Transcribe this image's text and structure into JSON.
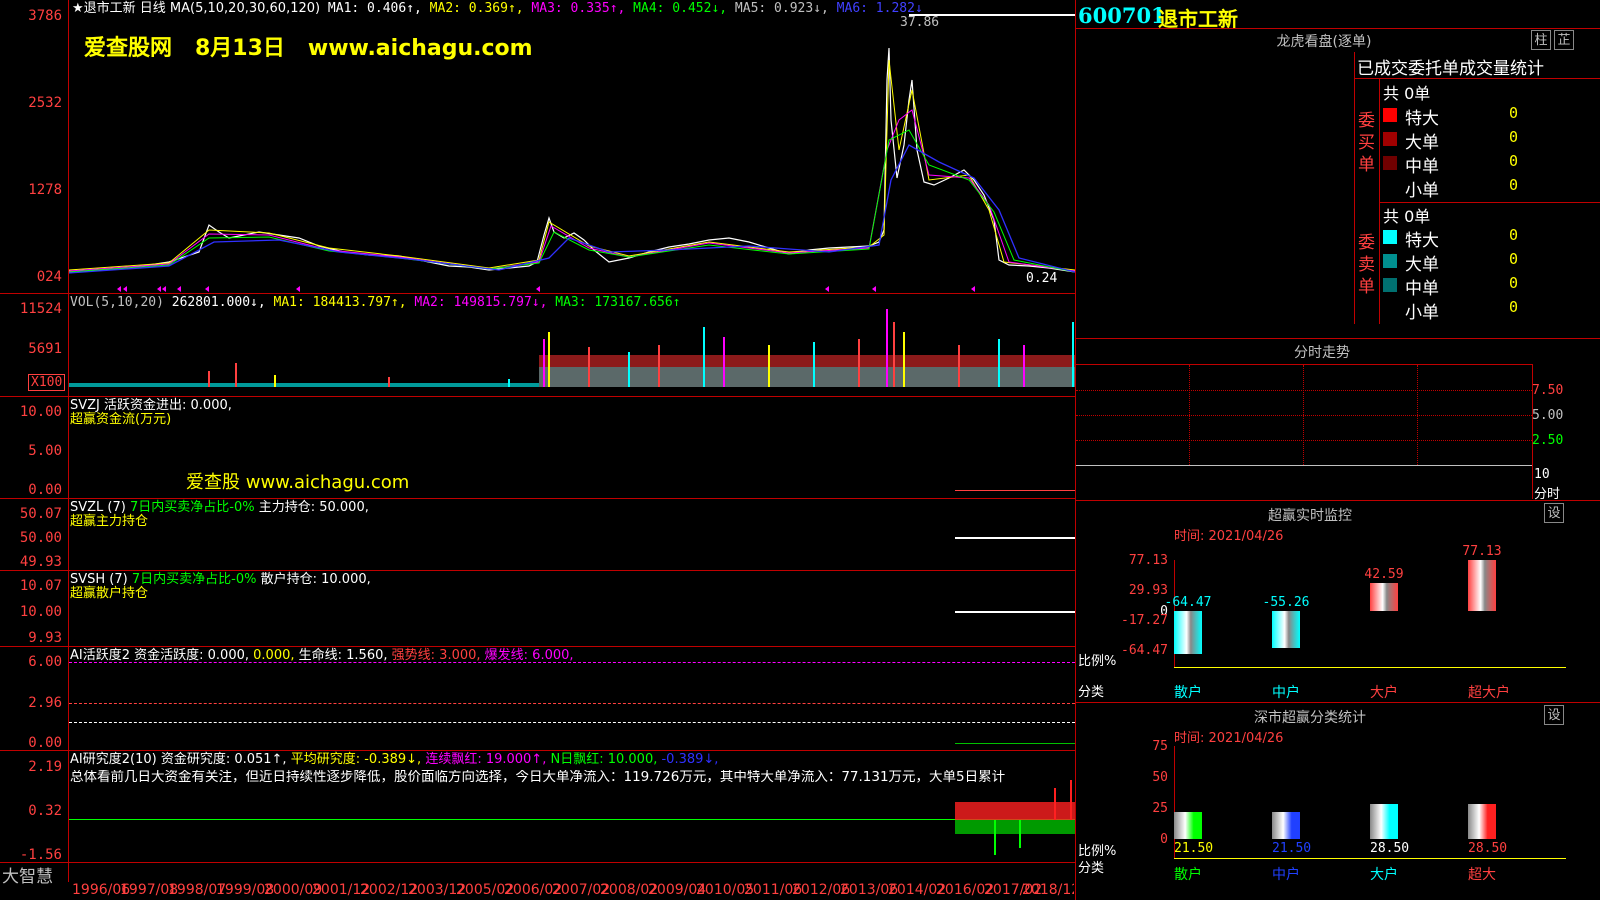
{
  "header": {
    "indicator_line": "★退市工新  日线 MA(5,10,20,30,60,120)",
    "ma1": "MA1: 0.406↑,",
    "ma2": "MA2: 0.369↑,",
    "ma3": "MA3: 0.335↑,",
    "ma4": "MA4: 0.452↓,",
    "ma5": "MA5: 0.923↓,",
    "ma6": "MA6: 1.282↓",
    "peak": "37.86",
    "last": "0.24"
  },
  "watermark1": "爱查股网   8月13日   www.aichagu.com",
  "watermark2": "爱查股 www.aichagu.com",
  "price_axis": [
    "3786",
    "2532",
    "1278",
    "024"
  ],
  "vol": {
    "title": "VOL(5,10,20)",
    "value": "262801.000↓,",
    "ma1": "MA1: 184413.797↑,",
    "ma2": "MA2: 149815.797↓,",
    "ma3": "MA3: 173167.656↑",
    "axis": [
      "11524",
      "5691"
    ],
    "unit": "X100"
  },
  "svzj": {
    "title": "SVZJ  活跃资金进出: 0.000,",
    "sub": "超赢资金流(万元)",
    "axis": [
      "10.00",
      "5.00",
      "0.00"
    ]
  },
  "svzl": {
    "title": "SVZL (7)",
    "green": "7日内买卖净占比-0%",
    "rest": "主力持仓: 50.000,",
    "sub": "超赢主力持仓",
    "axis": [
      "50.07",
      "50.00",
      "49.93"
    ]
  },
  "svsh": {
    "title": "SVSH (7)",
    "green": "7日内买卖净占比-0%",
    "rest": "散户持仓: 10.000,",
    "sub": "超赢散户持仓",
    "axis": [
      "10.07",
      "10.00",
      "9.93"
    ]
  },
  "ai_active": {
    "title": "AI活跃度2 资金活跃度: 0.000,",
    "yellow": "0.000,",
    "rest": "生命线: 1.560,",
    "red": "强势线: 3.000,",
    "mag": "爆发线: 6.000,",
    "axis": [
      "6.00",
      "2.96",
      "0.00"
    ]
  },
  "ai_research": {
    "title": "AI研究度2(10) 资金研究度: 0.051↑,",
    "avg": "平均研究度: -0.389↓,",
    "conred": "连续飘红: 19.000↑,",
    "nred": "N日飘红: 10.000,",
    "neg": "-0.389↓,",
    "summary": "总体看前几日大资金有关注，但近日持续性逐步降低，股价面临方向选择，今日大单净流入：119.726万元，其中特大单净流入：77.131万元，大单5日累计",
    "axis": [
      "2.19",
      "0.32",
      "-1.56"
    ]
  },
  "x_axis": [
    "1996/06",
    "1997/08",
    "1998/07",
    "1999/08",
    "2000/09",
    "2001/12",
    "2002/12",
    "2003/12",
    "2005/02",
    "2006/02",
    "2007/02",
    "2008/02",
    "2009/04",
    "2010/05",
    "2011/06",
    "2012/06",
    "2013/06",
    "2014/02",
    "2016/02",
    "2017/02",
    "2018/12"
  ],
  "bottom_brand": "大智慧",
  "right": {
    "code": "600701",
    "name": "退市工新",
    "dragon_title": "龙虎看盘(逐单)",
    "btn_zhu": "柱",
    "btn_zhi": "芷",
    "stats_title": "已成交委托单成交量统计",
    "buy_label": "委买单",
    "sell_label": "委卖单",
    "buy_total": "共 0单",
    "sell_total": "共 0单",
    "buy_rows": [
      {
        "label": "特大",
        "value": "0",
        "color": "#ff0000"
      },
      {
        "label": "大单",
        "value": "0",
        "color": "#a00000"
      },
      {
        "label": "中单",
        "value": "0",
        "color": "#700000"
      },
      {
        "label": "小单",
        "value": "0",
        "color": "#000000"
      }
    ],
    "sell_rows": [
      {
        "label": "特大",
        "value": "0",
        "color": "#00ffff"
      },
      {
        "label": "大单",
        "value": "0",
        "color": "#009090"
      },
      {
        "label": "中单",
        "value": "0",
        "color": "#007070"
      },
      {
        "label": "小单",
        "value": "0",
        "color": "#000000"
      }
    ],
    "fenshi_title": "分时走势",
    "fenshi_axis": [
      "7.50",
      "5.00",
      "2.50"
    ],
    "fenshi_x": "10",
    "fenshi_unit": "分时",
    "monitor_title": "超赢实时监控",
    "monitor_btn": "设",
    "monitor_time": "时间: 2021/04/26",
    "monitor_axis": [
      "77.13",
      "29.93",
      "0",
      "-17.27",
      "-64.47"
    ],
    "monitor_ratio": "比例%",
    "monitor_cat": "分类",
    "monitor_bars": [
      {
        "label": "散户",
        "value": "-64.47",
        "color": "#00ffff"
      },
      {
        "label": "中户",
        "value": "-55.26",
        "color": "#00ffff"
      },
      {
        "label": "大户",
        "value": "42.59",
        "color": "#ff4040"
      },
      {
        "label": "超大户",
        "value": "77.13",
        "color": "#ff4040"
      }
    ],
    "sz_title": "深市超赢分类统计",
    "sz_btn": "设",
    "sz_time": "时间: 2021/04/26",
    "sz_axis": [
      "75",
      "50",
      "25",
      "0"
    ],
    "sz_ratio": "比例%",
    "sz_cat": "分类",
    "sz_bars": [
      {
        "label": "散户",
        "value": "21.50",
        "color": "#00ff00",
        "val_color": "#ffff00"
      },
      {
        "label": "中户",
        "value": "21.50",
        "color": "#2040ff",
        "val_color": "#2040ff"
      },
      {
        "label": "大户",
        "value": "28.50",
        "color": "#00ffff",
        "val_color": "#ffffff"
      },
      {
        "label": "超大",
        "value": "28.50",
        "color": "#ff2020",
        "val_color": "#ff4040"
      }
    ]
  }
}
